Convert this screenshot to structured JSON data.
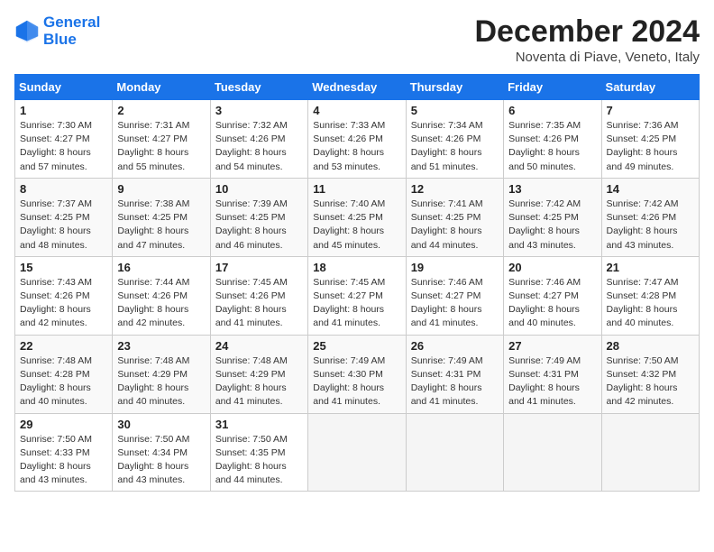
{
  "header": {
    "logo_line1": "General",
    "logo_line2": "Blue",
    "month": "December 2024",
    "location": "Noventa di Piave, Veneto, Italy"
  },
  "days_of_week": [
    "Sunday",
    "Monday",
    "Tuesday",
    "Wednesday",
    "Thursday",
    "Friday",
    "Saturday"
  ],
  "weeks": [
    [
      {
        "day": "1",
        "info": "Sunrise: 7:30 AM\nSunset: 4:27 PM\nDaylight: 8 hours\nand 57 minutes."
      },
      {
        "day": "2",
        "info": "Sunrise: 7:31 AM\nSunset: 4:27 PM\nDaylight: 8 hours\nand 55 minutes."
      },
      {
        "day": "3",
        "info": "Sunrise: 7:32 AM\nSunset: 4:26 PM\nDaylight: 8 hours\nand 54 minutes."
      },
      {
        "day": "4",
        "info": "Sunrise: 7:33 AM\nSunset: 4:26 PM\nDaylight: 8 hours\nand 53 minutes."
      },
      {
        "day": "5",
        "info": "Sunrise: 7:34 AM\nSunset: 4:26 PM\nDaylight: 8 hours\nand 51 minutes."
      },
      {
        "day": "6",
        "info": "Sunrise: 7:35 AM\nSunset: 4:26 PM\nDaylight: 8 hours\nand 50 minutes."
      },
      {
        "day": "7",
        "info": "Sunrise: 7:36 AM\nSunset: 4:25 PM\nDaylight: 8 hours\nand 49 minutes."
      }
    ],
    [
      {
        "day": "8",
        "info": "Sunrise: 7:37 AM\nSunset: 4:25 PM\nDaylight: 8 hours\nand 48 minutes."
      },
      {
        "day": "9",
        "info": "Sunrise: 7:38 AM\nSunset: 4:25 PM\nDaylight: 8 hours\nand 47 minutes."
      },
      {
        "day": "10",
        "info": "Sunrise: 7:39 AM\nSunset: 4:25 PM\nDaylight: 8 hours\nand 46 minutes."
      },
      {
        "day": "11",
        "info": "Sunrise: 7:40 AM\nSunset: 4:25 PM\nDaylight: 8 hours\nand 45 minutes."
      },
      {
        "day": "12",
        "info": "Sunrise: 7:41 AM\nSunset: 4:25 PM\nDaylight: 8 hours\nand 44 minutes."
      },
      {
        "day": "13",
        "info": "Sunrise: 7:42 AM\nSunset: 4:25 PM\nDaylight: 8 hours\nand 43 minutes."
      },
      {
        "day": "14",
        "info": "Sunrise: 7:42 AM\nSunset: 4:26 PM\nDaylight: 8 hours\nand 43 minutes."
      }
    ],
    [
      {
        "day": "15",
        "info": "Sunrise: 7:43 AM\nSunset: 4:26 PM\nDaylight: 8 hours\nand 42 minutes."
      },
      {
        "day": "16",
        "info": "Sunrise: 7:44 AM\nSunset: 4:26 PM\nDaylight: 8 hours\nand 42 minutes."
      },
      {
        "day": "17",
        "info": "Sunrise: 7:45 AM\nSunset: 4:26 PM\nDaylight: 8 hours\nand 41 minutes."
      },
      {
        "day": "18",
        "info": "Sunrise: 7:45 AM\nSunset: 4:27 PM\nDaylight: 8 hours\nand 41 minutes."
      },
      {
        "day": "19",
        "info": "Sunrise: 7:46 AM\nSunset: 4:27 PM\nDaylight: 8 hours\nand 41 minutes."
      },
      {
        "day": "20",
        "info": "Sunrise: 7:46 AM\nSunset: 4:27 PM\nDaylight: 8 hours\nand 40 minutes."
      },
      {
        "day": "21",
        "info": "Sunrise: 7:47 AM\nSunset: 4:28 PM\nDaylight: 8 hours\nand 40 minutes."
      }
    ],
    [
      {
        "day": "22",
        "info": "Sunrise: 7:48 AM\nSunset: 4:28 PM\nDaylight: 8 hours\nand 40 minutes."
      },
      {
        "day": "23",
        "info": "Sunrise: 7:48 AM\nSunset: 4:29 PM\nDaylight: 8 hours\nand 40 minutes."
      },
      {
        "day": "24",
        "info": "Sunrise: 7:48 AM\nSunset: 4:29 PM\nDaylight: 8 hours\nand 41 minutes."
      },
      {
        "day": "25",
        "info": "Sunrise: 7:49 AM\nSunset: 4:30 PM\nDaylight: 8 hours\nand 41 minutes."
      },
      {
        "day": "26",
        "info": "Sunrise: 7:49 AM\nSunset: 4:31 PM\nDaylight: 8 hours\nand 41 minutes."
      },
      {
        "day": "27",
        "info": "Sunrise: 7:49 AM\nSunset: 4:31 PM\nDaylight: 8 hours\nand 41 minutes."
      },
      {
        "day": "28",
        "info": "Sunrise: 7:50 AM\nSunset: 4:32 PM\nDaylight: 8 hours\nand 42 minutes."
      }
    ],
    [
      {
        "day": "29",
        "info": "Sunrise: 7:50 AM\nSunset: 4:33 PM\nDaylight: 8 hours\nand 43 minutes."
      },
      {
        "day": "30",
        "info": "Sunrise: 7:50 AM\nSunset: 4:34 PM\nDaylight: 8 hours\nand 43 minutes."
      },
      {
        "day": "31",
        "info": "Sunrise: 7:50 AM\nSunset: 4:35 PM\nDaylight: 8 hours\nand 44 minutes."
      },
      {
        "day": "",
        "info": ""
      },
      {
        "day": "",
        "info": ""
      },
      {
        "day": "",
        "info": ""
      },
      {
        "day": "",
        "info": ""
      }
    ]
  ]
}
